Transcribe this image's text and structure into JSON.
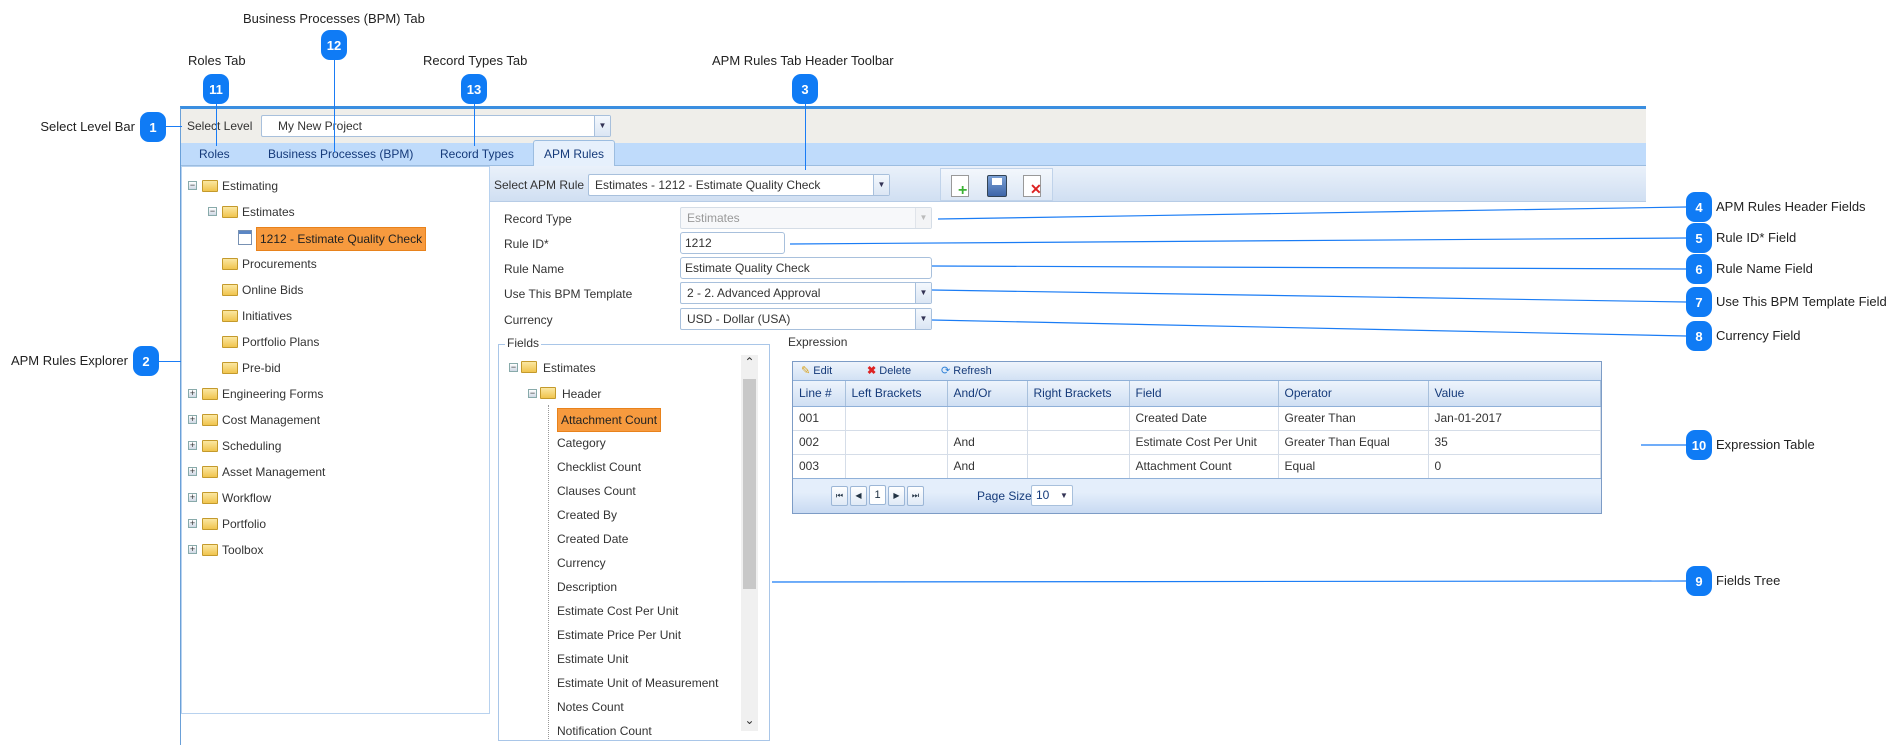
{
  "annotations": [
    {
      "num": "1",
      "label": "Select Level Bar"
    },
    {
      "num": "2",
      "label": "APM Rules Explorer"
    },
    {
      "num": "3",
      "label": "APM Rules Tab Header Toolbar"
    },
    {
      "num": "4",
      "label": "APM Rules Header Fields"
    },
    {
      "num": "5",
      "label": "Rule ID* Field"
    },
    {
      "num": "6",
      "label": "Rule Name Field"
    },
    {
      "num": "7",
      "label": "Use This BPM Template Field"
    },
    {
      "num": "8",
      "label": "Currency Field"
    },
    {
      "num": "9",
      "label": "Fields Tree"
    },
    {
      "num": "10",
      "label": "Expression Table"
    },
    {
      "num": "11",
      "label": "Roles Tab"
    },
    {
      "num": "12",
      "label": "Business Processes (BPM) Tab"
    },
    {
      "num": "13",
      "label": "Record Types Tab"
    }
  ],
  "colors": {
    "badge": "#0f7bf5",
    "selected": "#f79a3e",
    "tab_bar": "#bfdbfb"
  },
  "select_level": {
    "label": "Select Level",
    "value": "My New Project"
  },
  "tabs": [
    "Roles",
    "Business Processes (BPM)",
    "Record Types",
    "APM Rules"
  ],
  "active_tab": "APM Rules",
  "explorer": [
    {
      "label": "Estimating",
      "level": 0,
      "expander": "minus",
      "icon": "folder"
    },
    {
      "label": "Estimates",
      "level": 1,
      "expander": "minus",
      "icon": "folder"
    },
    {
      "label": "1212 - Estimate Quality Check",
      "level": 2,
      "icon": "rule",
      "selected": true
    },
    {
      "label": "Procurements",
      "level": 1,
      "icon": "folder"
    },
    {
      "label": "Online Bids",
      "level": 1,
      "icon": "folder"
    },
    {
      "label": "Initiatives",
      "level": 1,
      "icon": "folder"
    },
    {
      "label": "Portfolio Plans",
      "level": 1,
      "icon": "folder"
    },
    {
      "label": "Pre-bid",
      "level": 1,
      "icon": "folder"
    },
    {
      "label": "Engineering Forms",
      "level": 0,
      "expander": "plus",
      "icon": "folder"
    },
    {
      "label": "Cost Management",
      "level": 0,
      "expander": "plus",
      "icon": "folder"
    },
    {
      "label": "Scheduling",
      "level": 0,
      "expander": "plus",
      "icon": "folder"
    },
    {
      "label": "Asset Management",
      "level": 0,
      "expander": "plus",
      "icon": "folder"
    },
    {
      "label": "Workflow",
      "level": 0,
      "expander": "plus",
      "icon": "folder"
    },
    {
      "label": "Portfolio",
      "level": 0,
      "expander": "plus",
      "icon": "folder"
    },
    {
      "label": "Toolbox",
      "level": 0,
      "expander": "plus",
      "icon": "folder"
    }
  ],
  "apm_toolbar": {
    "label": "Select APM Rule",
    "value": "Estimates - 1212 - Estimate Quality Check",
    "icons": [
      "new-document-icon",
      "save-icon",
      "delete-document-icon"
    ]
  },
  "form": {
    "record_type": {
      "label": "Record Type",
      "value": "Estimates"
    },
    "rule_id": {
      "label": "Rule ID*",
      "value": "1212"
    },
    "rule_name": {
      "label": "Rule Name",
      "value": "Estimate Quality Check"
    },
    "bpm_template": {
      "label": "Use This BPM Template",
      "value": "2 - 2. Advanced Approval"
    },
    "currency": {
      "label": "Currency",
      "value": "USD - Dollar (USA)"
    }
  },
  "fields": {
    "legend": "Fields",
    "root": "Estimates",
    "group": "Header",
    "items": [
      "Attachment Count",
      "Category",
      "Checklist Count",
      "Clauses Count",
      "Created By",
      "Created Date",
      "Currency",
      "Description",
      "Estimate Cost Per Unit",
      "Estimate Price Per Unit",
      "Estimate Unit",
      "Estimate Unit of Measurement",
      "Notes Count",
      "Notification Count"
    ],
    "selected": "Attachment Count"
  },
  "expression": {
    "legend": "Expression",
    "toolbar": {
      "edit": "Edit",
      "delete": "Delete",
      "refresh": "Refresh"
    },
    "columns": [
      "Line #",
      "Left Brackets",
      "And/Or",
      "Right Brackets",
      "Field",
      "Operator",
      "Value"
    ],
    "rows": [
      [
        "001",
        "",
        "",
        "",
        "Created Date",
        "Greater Than",
        "Jan-01-2017"
      ],
      [
        "002",
        "",
        "And",
        "",
        "Estimate Cost Per Unit",
        "Greater Than Equal",
        "35"
      ],
      [
        "003",
        "",
        "And",
        "",
        "Attachment Count",
        "Equal",
        "0"
      ]
    ],
    "pager": {
      "current_page": "1",
      "page_size_label": "Page Size",
      "page_size": "10"
    }
  }
}
